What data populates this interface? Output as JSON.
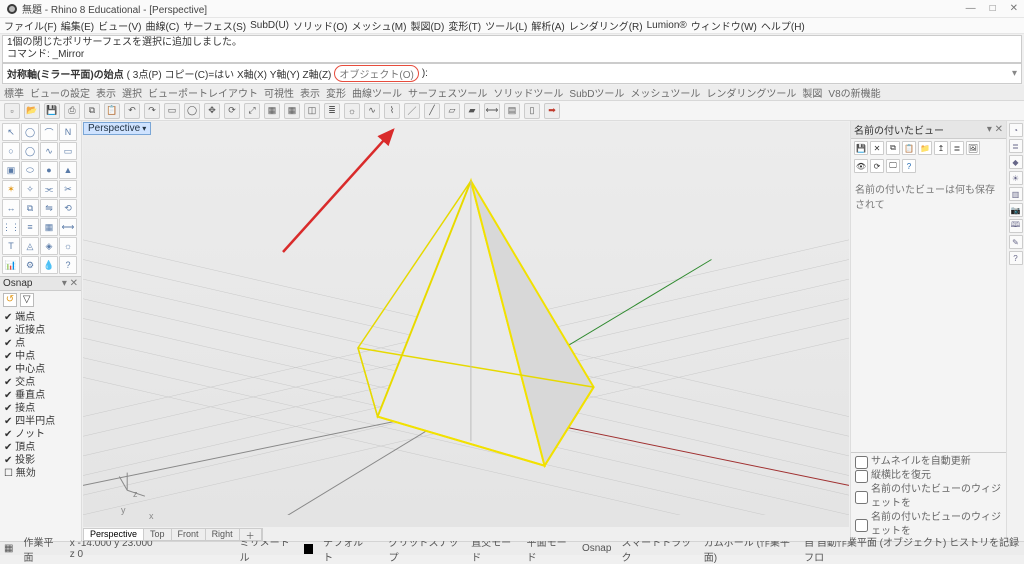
{
  "titlebar": {
    "title": "無題 - Rhino 8 Educational - [Perspective]"
  },
  "menubar": [
    "ファイル(F)",
    "編集(E)",
    "ビュー(V)",
    "曲線(C)",
    "サーフェス(S)",
    "SubD(U)",
    "ソリッド(O)",
    "メッシュ(M)",
    "製図(D)",
    "変形(T)",
    "ツール(L)",
    "解析(A)",
    "レンダリング(R)",
    "Lumion®",
    "ウィンドウ(W)",
    "ヘルプ(H)"
  ],
  "cmdlog": {
    "line1": "1個の閉じたポリサーフェスを選択に追加しました。",
    "line2": "コマンド: _Mirror"
  },
  "cmdline": {
    "prompt": "対称軸(ミラー平面)の始点",
    "opts": "( 3点(P) コピー(C)=はい X軸(X) Y軸(Y) Z軸(Z)",
    "highlight": "オブジェクト(O)",
    "close": " ):"
  },
  "tabs": [
    "標準",
    "ビューの設定",
    "表示",
    "選択",
    "ビューポートレイアウト",
    "可視性",
    "表示",
    "変形",
    "曲線ツール",
    "サーフェスツール",
    "ソリッドツール",
    "SubDツール",
    "メッシュツール",
    "レンダリングツール",
    "製図",
    "V8の新機能"
  ],
  "osnap": {
    "title": "Osnap",
    "items": [
      "端点",
      "近接点",
      "点",
      "中点",
      "中心点",
      "交点",
      "垂直点",
      "接点",
      "四半円点",
      "ノット",
      "頂点",
      "投影"
    ],
    "disabled": "無効"
  },
  "viewport": {
    "label": "Perspective",
    "tabs": [
      "Perspective",
      "Top",
      "Front",
      "Right"
    ],
    "axes": {
      "x": "x",
      "y": "y",
      "z": "z"
    }
  },
  "rightpanel": {
    "title": "名前の付いたビュー",
    "msg": "名前の付いたビューは何も保存されて",
    "checks": [
      "サムネイルを自動更新",
      "縦横比を復元",
      "名前の付いたビューのウィジェットを",
      "名前の付いたビューのウィジェットを"
    ]
  },
  "status": {
    "cplane": "作業平面",
    "coords": "x -14.000  y 23.000  z 0",
    "units": "ミリメートル",
    "layer": "デフォルト",
    "buttons": [
      "グリッドスナップ",
      "直交モード",
      "平面モード",
      "Osnap",
      "スマートトラック",
      "ガムボール (作業平面)"
    ],
    "tail": "自 自動作業平面 (オブジェクト)  ヒストリを記録  フロ"
  }
}
